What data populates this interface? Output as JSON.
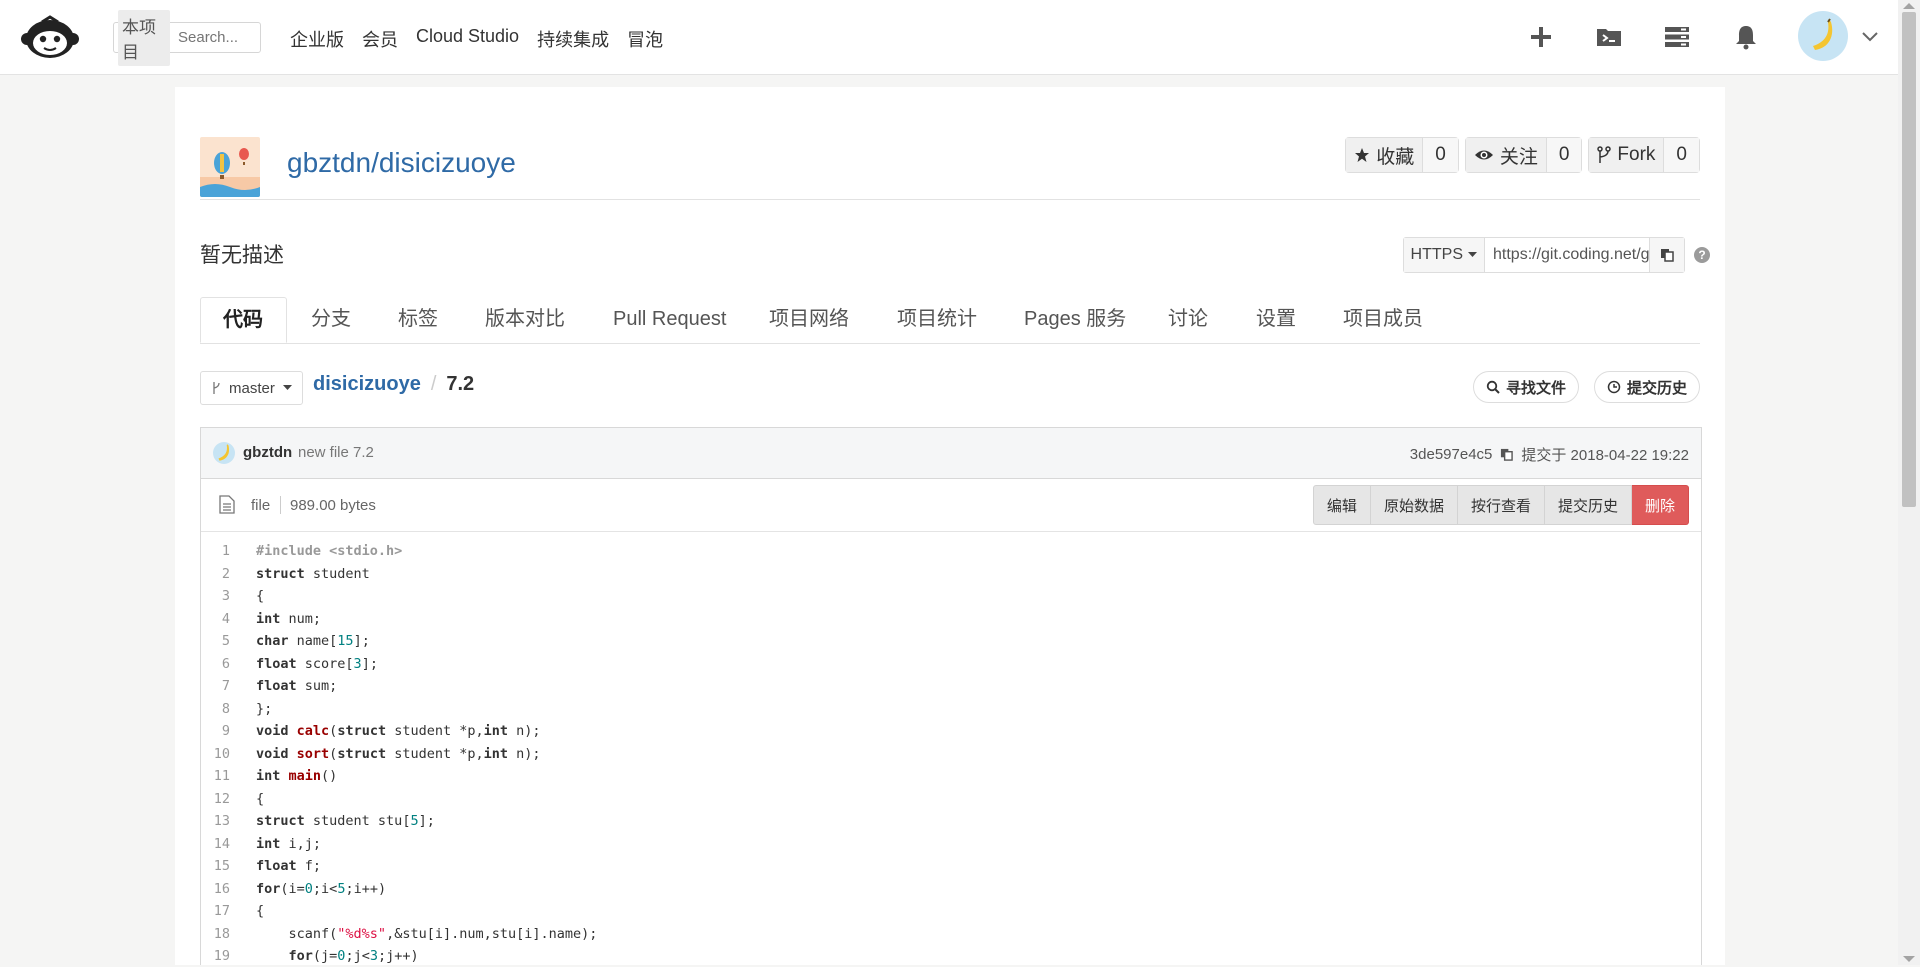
{
  "nav": {
    "scope": "本项目",
    "search_placeholder": "Search...",
    "links": [
      "企业版",
      "会员",
      "Cloud Studio",
      "持续集成",
      "冒泡"
    ]
  },
  "repo": {
    "name": "gbztdn/disicizuoye",
    "stats": [
      {
        "label": "收藏",
        "count": "0",
        "icon": "star-icon"
      },
      {
        "label": "关注",
        "count": "0",
        "icon": "eye-icon"
      },
      {
        "label": "Fork",
        "count": "0",
        "icon": "fork-icon"
      }
    ],
    "description": "暂无描述",
    "clone_protocol": "HTTPS",
    "clone_url": "https://git.coding.net/gbztdn/disicizuoye.git"
  },
  "tabs": [
    "代码",
    "分支",
    "标签",
    "版本对比",
    "Pull Request",
    "项目网络",
    "项目统计",
    "Pages 服务",
    "讨论",
    "设置",
    "项目成员"
  ],
  "branchbar": {
    "branch": "master",
    "crumb_repo": "disicizuoye",
    "crumb_sep": "/",
    "crumb_file": "7.2",
    "find_file": "寻找文件",
    "history": "提交历史"
  },
  "commit": {
    "author": "gbztdn",
    "message": "new file 7.2",
    "hash": "3de597e4c5",
    "time": "提交于 2018-04-22 19:22"
  },
  "file": {
    "type": "file",
    "size": "989.00 bytes",
    "buttons": [
      "编辑",
      "原始数据",
      "按行查看",
      "提交历史"
    ],
    "delete": "删除"
  },
  "code_lines": [
    "#include <stdio.h>",
    "struct student",
    "{",
    "int num;",
    "char name[15];",
    "float score[3];",
    "float sum;",
    "};",
    "void calc(struct student *p,int n);",
    "void sort(struct student *p,int n);",
    "int main()",
    "{",
    "struct student stu[5];",
    "int i,j;",
    "float f;",
    "for(i=0;i<5;i++)",
    "{",
    "    scanf(\"%d%s\",&stu[i].num,stu[i].name);",
    "    for(j=0;j<3;j++)"
  ]
}
